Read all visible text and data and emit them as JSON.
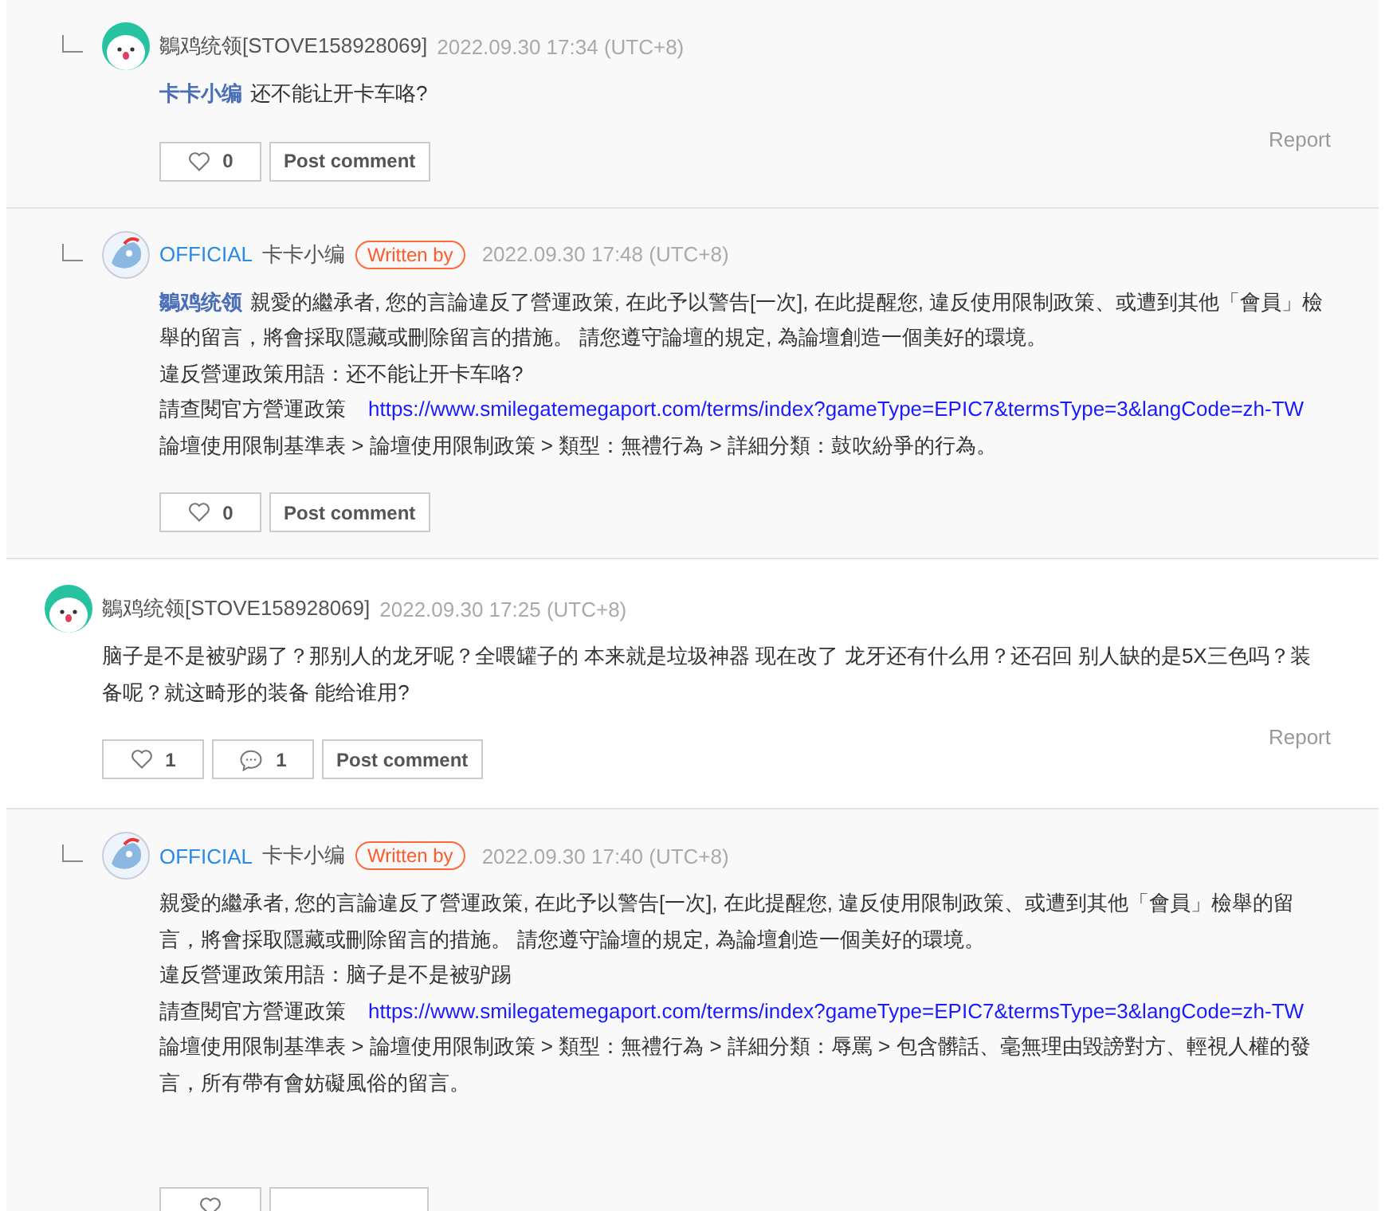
{
  "comments": [
    {
      "kind": "reply",
      "author": {
        "kind": "user",
        "name": "鶵鸡统领[STOVE158928069]"
      },
      "time": "2022.09.30 17:34 (UTC+8)",
      "mention": "卡卡小编",
      "lines": [
        {
          "text": "还不能让开卡车咯?"
        }
      ],
      "likes": "0",
      "post": "Post comment",
      "report": "Report"
    },
    {
      "kind": "reply",
      "author": {
        "kind": "official",
        "label": "OFFICIAL",
        "name": "卡卡小编",
        "badge": "Written by"
      },
      "time": "2022.09.30 17:48 (UTC+8)",
      "mention": "鶵鸡统领",
      "lines": [
        {
          "text": "親愛的繼承者, 您的言論違反了營運政策, 在此予以警告[一次], 在此提醒您, 違反使用限制政策、或遭到其他「會員」檢舉的留言，將會採取隱藏或刪除留言的措施。 請您遵守論壇的規定, 為論壇創造一個美好的環境。"
        },
        {
          "text": "違反營運政策用語：还不能让开卡车咯?"
        },
        {
          "text": "請查閱官方營運政策",
          "link": "https://www.smilegatemegaport.com/terms/index?gameType=EPIC7&termsType=3&langCode=zh-TW"
        },
        {
          "text": "論壇使用限制基準表 > 論壇使用限制政策 > 類型：無禮行為 > 詳細分類：鼓吹紛爭的行為。"
        }
      ],
      "likes": "0",
      "post": "Post comment"
    },
    {
      "kind": "top",
      "author": {
        "kind": "user",
        "name": "鶵鸡统领[STOVE158928069]"
      },
      "time": "2022.09.30 17:25 (UTC+8)",
      "lines": [
        {
          "text": "脑子是不是被驴踢了？那别人的龙牙呢？全喂罐子的 本来就是垃圾神器 现在改了 龙牙还有什么用？还召回 别人缺的是5X三色吗？装备呢？就这畸形的装备 能给谁用?"
        }
      ],
      "likes": "1",
      "replies": "1",
      "post": "Post comment",
      "report": "Report"
    },
    {
      "kind": "reply",
      "author": {
        "kind": "official",
        "label": "OFFICIAL",
        "name": "卡卡小编",
        "badge": "Written by"
      },
      "time": "2022.09.30 17:40 (UTC+8)",
      "lines": [
        {
          "text": "親愛的繼承者, 您的言論違反了營運政策, 在此予以警告[一次], 在此提醒您, 違反使用限制政策、或遭到其他「會員」檢舉的留言，將會採取隱藏或刪除留言的措施。 請您遵守論壇的規定, 為論壇創造一個美好的環境。"
        },
        {
          "text": "違反營運政策用語：脑子是不是被驴踢"
        },
        {
          "text": "請查閱官方營運政策",
          "link": "https://www.smilegatemegaport.com/terms/index?gameType=EPIC7&termsType=3&langCode=zh-TW"
        },
        {
          "text": "論壇使用限制基準表 > 論壇使用限制政策 > 類型：無禮行為 > 詳細分類：辱罵 > 包含髒話、毫無理由毀謗對方、輕視人權的發言，所有帶有會妨礙風俗的留言。"
        }
      ]
    }
  ]
}
